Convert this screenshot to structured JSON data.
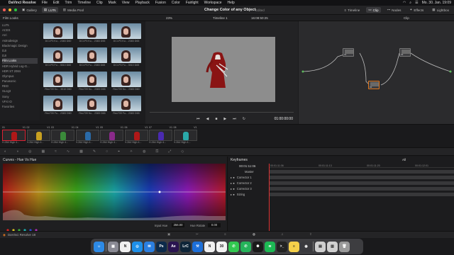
{
  "menubar": {
    "app_name": "DaVinci Resolve",
    "items": [
      "File",
      "Edit",
      "Trim",
      "Timeline",
      "Clip",
      "Mark",
      "View",
      "Playback",
      "Fusion",
      "Color",
      "Fairlight",
      "Workspace",
      "Help"
    ],
    "clock": "Mo. 30. Jan. 19:09"
  },
  "toolbar": {
    "gallery": "Gallery",
    "luts": "LUTs",
    "media_pool": "Media Pool",
    "project_title": "Change Color of any Object",
    "edited": "Edited",
    "timeline": "Timeline",
    "clip": "Clip",
    "nodes": "Nodes",
    "effects": "Effects",
    "lightbox": "Lightbox"
  },
  "subbar": {
    "panel_title": "Film Looks",
    "zoom": "23%",
    "timeline_name": "Timeline 1",
    "timecode": "16:08:50:25",
    "node_mode": "Clip"
  },
  "lut_tree": {
    "items": [
      "LUTs",
      "ACES",
      "Arri",
      "Astrodesign",
      "Blackmagic Design",
      "DJI",
      "DJI",
      "Film Looks",
      "HDR Hybrid Log-G...",
      "HDR ST 2084",
      "Olympus",
      "Panasonic",
      "RED",
      "SLog3",
      "Sony",
      "VFX IO",
      "Favorites"
    ],
    "selected_index": 7
  },
  "lut_thumbs": [
    "DCI-P3 Ku... 2383 D60",
    "DCI-P3 Ku... 2383 D55",
    "DCI-P3 Ku... 2383 D65",
    "DCI-P3 Fu... 3510 D60",
    "DCI-P3 Fu... 2383 D65",
    "DCI-P3 Fu... 3510 D65",
    "Rec709 Ku... 3510 D60",
    "Rec709 Ku... 2383 D55",
    "Rec709 Ku... 2383 D60",
    "Rec709 Fu... 2383 D60",
    "Rec709 Ku... 2383 D65",
    "Rec709 Fu... 2383 D65"
  ],
  "viewer": {
    "playback_time": "01:00:00:00"
  },
  "nodes": {
    "labels": [
      "01",
      "03",
      "02"
    ]
  },
  "clips": [
    {
      "num": "01",
      "track": "V1",
      "name": "H.264 High 4...",
      "color": "#b01818"
    },
    {
      "num": "02",
      "track": "V1",
      "name": "H.264 High 4...",
      "color": "#c8a020"
    },
    {
      "num": "03",
      "track": "V1",
      "name": "H.264 High 4...",
      "color": "#3a8a3a"
    },
    {
      "num": "04",
      "track": "V1",
      "name": "H.264 High 4...",
      "color": "#2a6aa8"
    },
    {
      "num": "05",
      "track": "V1",
      "name": "H.264 High 4...",
      "color": "#8a2a8a"
    },
    {
      "num": "06",
      "track": "V1",
      "name": "H.264 High 4...",
      "color": "#b01818"
    },
    {
      "num": "07",
      "track": "V1",
      "name": "H.264 High 4...",
      "color": "#4a2ab0"
    },
    {
      "num": "08",
      "track": "V1",
      "name": "H.264 High 4...",
      "color": "#2aa8a8"
    }
  ],
  "curves": {
    "title": "Curves - Hue Vs Hue",
    "input_hue_label": "Input Hue",
    "input_hue_value": "256.00",
    "hue_rotate_label": "Hue Rotate",
    "hue_rotate_value": "0.00"
  },
  "keyframes": {
    "title": "Keyframes",
    "timecode": "00:01:11:06",
    "filter": "All",
    "ruler": [
      "00:01:11:06",
      "00:01:11:13",
      "00:01:11:20",
      "00:01:12:01"
    ],
    "rows": [
      "Master",
      "Corrector 1",
      "Corrector 2",
      "Corrector 3",
      "Sizing"
    ]
  },
  "status": {
    "app": "DaVinci Resolve 18"
  },
  "dock": {
    "apps": [
      {
        "name": "Finder",
        "glyph": "☺",
        "color": "#2d8ae6"
      },
      {
        "name": "Launchpad",
        "glyph": "▦",
        "color": "#8a8a94"
      },
      {
        "name": "Notion",
        "glyph": "N",
        "color": "#f0f0f0"
      },
      {
        "name": "Safari",
        "glyph": "◎",
        "color": "#1e8fe8"
      },
      {
        "name": "Mail",
        "glyph": "✉",
        "color": "#2b7fe0"
      },
      {
        "name": "Photoshop",
        "glyph": "Ps",
        "color": "#0c2a4a"
      },
      {
        "name": "After Effects",
        "glyph": "Ae",
        "color": "#2a1450"
      },
      {
        "name": "Lightroom Classic",
        "glyph": "LrC",
        "color": "#0e2538"
      },
      {
        "name": "Xcode",
        "glyph": "⚒",
        "color": "#1d6fd8"
      },
      {
        "name": "Notion",
        "glyph": "N",
        "color": "#f0f0f0"
      },
      {
        "name": "Calendar",
        "glyph": "30",
        "color": "#f2f2f2"
      },
      {
        "name": "Messages",
        "glyph": "✆",
        "color": "#32c850"
      },
      {
        "name": "WhatsApp",
        "glyph": "✆",
        "color": "#25b35a"
      },
      {
        "name": "ChatGPT",
        "glyph": "✺",
        "color": "#1a1a1a"
      },
      {
        "name": "Spotify",
        "glyph": "≋",
        "color": "#1db954"
      },
      {
        "name": "Terminal",
        "glyph": ">_",
        "color": "#222"
      },
      {
        "name": "Notes",
        "glyph": "≡",
        "color": "#f5d04a"
      },
      {
        "name": "DaVinci Resolve",
        "glyph": "◉",
        "color": "#3a3a3e"
      },
      {
        "name": "Preview",
        "glyph": "▤",
        "color": "#cfcfcf"
      },
      {
        "name": "Files",
        "glyph": "▥",
        "color": "#d0d0d0"
      },
      {
        "name": "Trash",
        "glyph": "🗑",
        "color": "#9a9a9a"
      }
    ]
  }
}
